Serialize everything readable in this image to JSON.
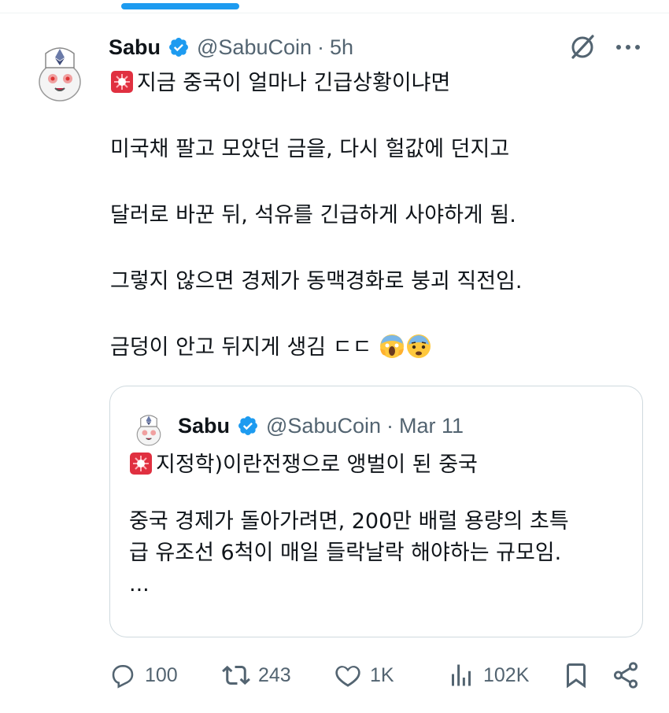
{
  "tweet": {
    "author_name": "Sabu",
    "handle": "@SabuCoin",
    "separator": "·",
    "time": "5h",
    "lines": [
      "지금 중국이 얼마나 긴급상황이냐면",
      "미국채 팔고 모았던 금을, 다시 헐값에 던지고",
      "달러로 바꾼 뒤, 석유를 긴급하게 사야하게 됨.",
      "그렇지 않으면 경제가 동맥경화로 붕괴 직전임.",
      "금덩이 안고 뒤지게 생김 ㄷㄷ"
    ]
  },
  "quoted": {
    "author_name": "Sabu",
    "handle": "@SabuCoin",
    "separator": "·",
    "time": "Mar 11",
    "lines": [
      "지정학)이란전쟁으로 앵벌이 된 중국",
      "중국 경제가 돌아가려면, 200만 배럴 용량의 초특",
      "급 유조선 6척이 매일 들락날락 해야하는 규모임.",
      "..."
    ]
  },
  "actions": {
    "replies": "100",
    "reposts": "243",
    "likes": "1K",
    "views": "102K"
  },
  "icons": {
    "verified": "verified-badge-icon",
    "grok": "grok-icon",
    "more": "more-icon",
    "reply": "reply-icon",
    "repost": "repost-icon",
    "like": "heart-icon",
    "views": "views-icon",
    "bookmark": "bookmark-icon",
    "share": "share-icon",
    "siren": "siren-emoji",
    "scream": "scream-emoji",
    "fearful": "fearful-emoji"
  },
  "colors": {
    "accent": "#1d9bf0",
    "text": "#0f1419",
    "secondary": "#536471",
    "border": "#cfd9de"
  }
}
